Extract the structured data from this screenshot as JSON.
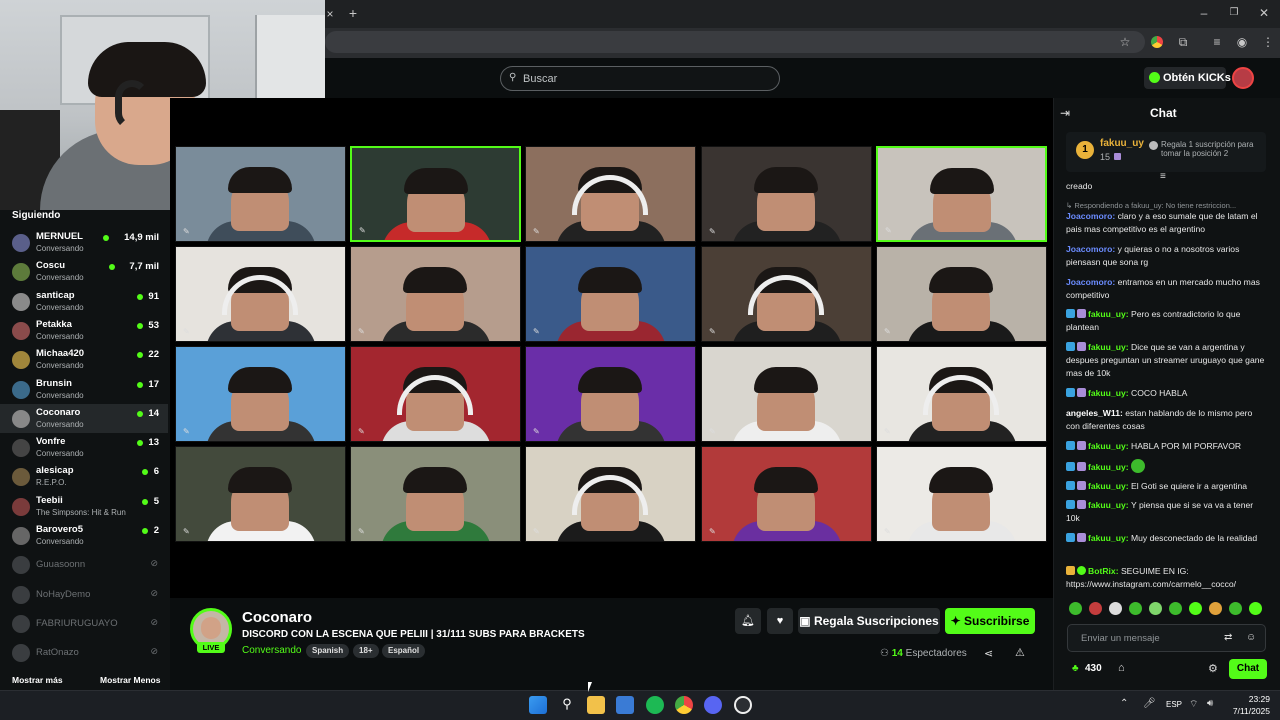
{
  "browser": {
    "tab_close": "×",
    "tab_new": "+",
    "window_controls": [
      "–",
      "❐",
      "✕"
    ]
  },
  "header": {
    "search_placeholder": "Buscar",
    "kicks_label": "Obtén KICKs"
  },
  "sidebar": {
    "title": "Siguiendo",
    "items": [
      {
        "name": "MERNUEL",
        "category": "Conversando",
        "viewers": "14,9 mil",
        "online": true
      },
      {
        "name": "Coscu",
        "category": "Conversando",
        "viewers": "7,7 mil",
        "online": true
      },
      {
        "name": "santicap",
        "category": "Conversando",
        "viewers": "91",
        "online": true
      },
      {
        "name": "Petakka",
        "category": "Conversando",
        "viewers": "53",
        "online": true
      },
      {
        "name": "Michaa420",
        "category": "Conversando",
        "viewers": "22",
        "online": true
      },
      {
        "name": "Brunsin",
        "category": "Conversando",
        "viewers": "17",
        "online": true
      },
      {
        "name": "Coconaro",
        "category": "Conversando",
        "viewers": "14",
        "online": true,
        "active": true
      },
      {
        "name": "Vonfre",
        "category": "Conversando",
        "viewers": "13",
        "online": true
      },
      {
        "name": "alesicap",
        "category": "R.E.P.O.",
        "viewers": "6",
        "online": true
      },
      {
        "name": "Teebii",
        "category": "The Simpsons: Hit & Run",
        "viewers": "5",
        "online": true
      },
      {
        "name": "Barovero5",
        "category": "Conversando",
        "viewers": "2",
        "online": true
      },
      {
        "name": "Guuasoonn",
        "online": false
      },
      {
        "name": "NoHayDemo",
        "online": false
      },
      {
        "name": "FABRIURUGUAYO",
        "online": false
      },
      {
        "name": "RatOnazo",
        "online": false
      }
    ],
    "show_more": "Mostrar más",
    "show_less": "Mostrar Menos"
  },
  "stream": {
    "channel": "Coconaro",
    "live": "LIVE",
    "title": "DISCORD CON LA ESCENA QUE PELIII | 31/111 SUBS PARA BRACKETS",
    "category": "Conversando",
    "tags": [
      "Spanish",
      "18+",
      "Español"
    ],
    "gift_label": "Regala Suscripciones",
    "subscribe_label": "Suscribirse",
    "viewers_count": "14",
    "viewers_label": "Espectadores"
  },
  "chat": {
    "title": "Chat",
    "pinned": {
      "rank": "1",
      "user": "fakuu_uy",
      "amount": "15",
      "text": "Regala 1 suscripción para tomar la posición 2"
    },
    "messages": [
      {
        "user": "",
        "text": "creado",
        "color": "#e8e8e8"
      },
      {
        "user": "",
        "text": "↳ Respondiendo a fakuu_uy: No tiene restriccion...",
        "color": "#8f9497",
        "reply": true
      },
      {
        "user": "Joacomoro",
        "text": "claro y a eso sumale que de latam el pais mas competitivo es el argentino",
        "color": "#6b8cff"
      },
      {
        "user": "Joacomoro",
        "text": "y quieras o no a nosotros varios piensasn que sona rg",
        "color": "#6b8cff"
      },
      {
        "user": "Joacomoro",
        "text": "entramos en un mercado mucho mas competitivo",
        "color": "#6b8cff"
      },
      {
        "user": "fakuu_uy",
        "text": "Pero es contradictorio lo que plantean",
        "color": "#53fc18",
        "badges": true
      },
      {
        "user": "fakuu_uy",
        "text": "Dice que se van a argentina y despues preguntan un streamer uruguayo que gane mas de 10k",
        "color": "#53fc18",
        "badges": true
      },
      {
        "user": "fakuu_uy",
        "text": "COCO HABLA",
        "color": "#53fc18",
        "badges": true
      },
      {
        "user": "angeles_W11",
        "text": "estan hablando de lo mismo pero con diferentes cosas",
        "color": "#ffffff"
      },
      {
        "user": "fakuu_uy",
        "text": "HABLA POR MI PORFAVOR",
        "color": "#53fc18",
        "badges": true
      },
      {
        "user": "fakuu_uy",
        "text": "",
        "color": "#53fc18",
        "badges": true,
        "emote": true
      },
      {
        "user": "fakuu_uy",
        "text": "El Goti se quiere ir a argentina",
        "color": "#53fc18",
        "badges": true
      },
      {
        "user": "fakuu_uy",
        "text": "Y piensa que si se va va a tener 10k",
        "color": "#53fc18",
        "badges": true
      },
      {
        "user": "fakuu_uy",
        "text": "Muy desconectado de la realidad",
        "color": "#53fc18",
        "badges": true
      },
      {
        "user": "BotRix",
        "text": "SEGUIME EN IG: https://www.instagram.com/carmelo__cocco/",
        "color": "#53fc18",
        "bot": true
      }
    ],
    "input_placeholder": "Enviar un mensaje",
    "points": "430",
    "send_label": "Chat"
  },
  "taskbar": {
    "lang": "ESP",
    "time": "23:29",
    "date": "7/11/2025"
  },
  "colors": {
    "accent": "#53fc18",
    "background": "#0b0e0f",
    "panel": "#0f1213"
  }
}
